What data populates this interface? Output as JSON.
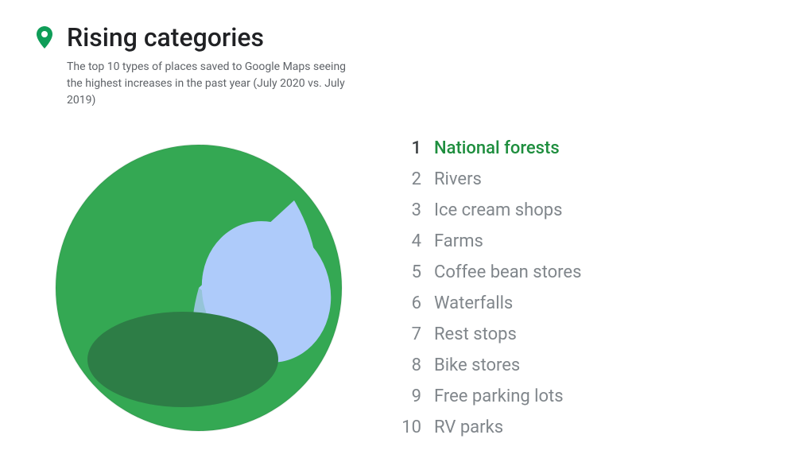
{
  "header": {
    "title": "Rising categories",
    "icon_label": "location-pin-icon"
  },
  "subtitle": "The top 10 types of places saved to Google Maps seeing the highest increases in the past year (July 2020 vs. July 2019)",
  "list": {
    "items": [
      {
        "rank": "1",
        "label": "National forests",
        "highlight": true
      },
      {
        "rank": "2",
        "label": "Rivers",
        "highlight": false
      },
      {
        "rank": "3",
        "label": "Ice cream shops",
        "highlight": false
      },
      {
        "rank": "4",
        "label": "Farms",
        "highlight": false
      },
      {
        "rank": "5",
        "label": "Coffee bean stores",
        "highlight": false
      },
      {
        "rank": "6",
        "label": "Waterfalls",
        "highlight": false
      },
      {
        "rank": "7",
        "label": "Rest stops",
        "highlight": false
      },
      {
        "rank": "8",
        "label": "Bike stores",
        "highlight": false
      },
      {
        "rank": "9",
        "label": "Free parking lots",
        "highlight": false
      },
      {
        "rank": "10",
        "label": "RV parks",
        "highlight": false
      }
    ]
  },
  "colors": {
    "green_dark": "#2d7d46",
    "green_medium": "#34a853",
    "green_light": "#81c995",
    "blue_light": "#aecbfa",
    "accent_green": "#1e8e3e",
    "pin_green": "#0f9d58"
  }
}
